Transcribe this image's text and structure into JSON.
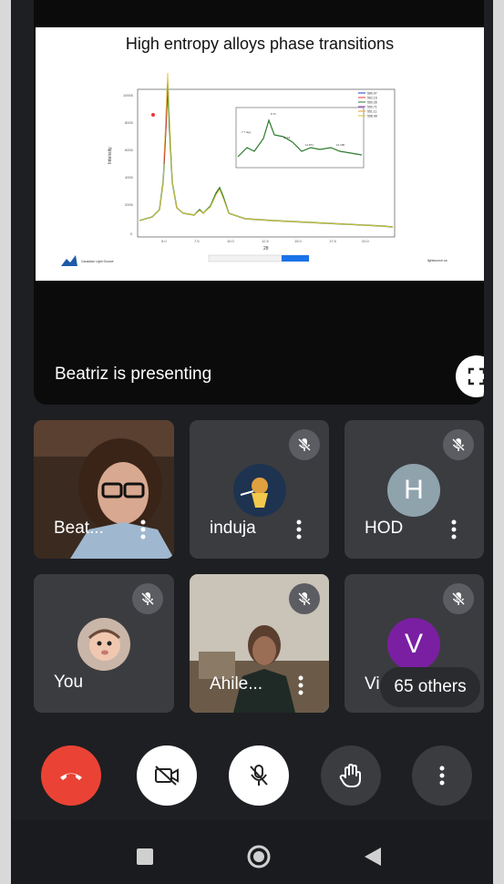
{
  "slide": {
    "title": "High entropy alloys phase transitions",
    "legend": [
      "580.97",
      "562.16",
      "550.35",
      "550.71",
      "551.11",
      "558.48"
    ],
    "inset_peaks": [
      "2 θ",
      "9.71",
      "11.16",
      "11.871",
      "14.180"
    ],
    "xlabel": "2θ",
    "ylabel": "Intensity",
    "footer_left": "Canadian Light Source",
    "footer_right": "lightsource.ca"
  },
  "presenting_label": "Beatriz is presenting",
  "tiles": {
    "beatriz": {
      "name": "Beat..."
    },
    "induja": {
      "name": "induja"
    },
    "hod": {
      "name": "HOD",
      "avatar_letter": "H",
      "avatar_color": "#8fa3ad"
    },
    "you": {
      "name": "You"
    },
    "ahile": {
      "name": "Ahile..."
    },
    "vi": {
      "name": "Vi",
      "avatar_letter": "V",
      "avatar_color": "#7b1fa2"
    }
  },
  "others_label": "65 others",
  "colors": {
    "end_call": "#ea4335",
    "tile_bg": "#3b3c40",
    "app_bg": "#1e1f22"
  },
  "icons": [
    "fullscreen-icon",
    "mic-off-icon",
    "more-vert-icon",
    "end-call-icon",
    "camera-off-icon",
    "raise-hand-icon",
    "nav-square-icon",
    "nav-home-icon",
    "nav-back-icon"
  ]
}
